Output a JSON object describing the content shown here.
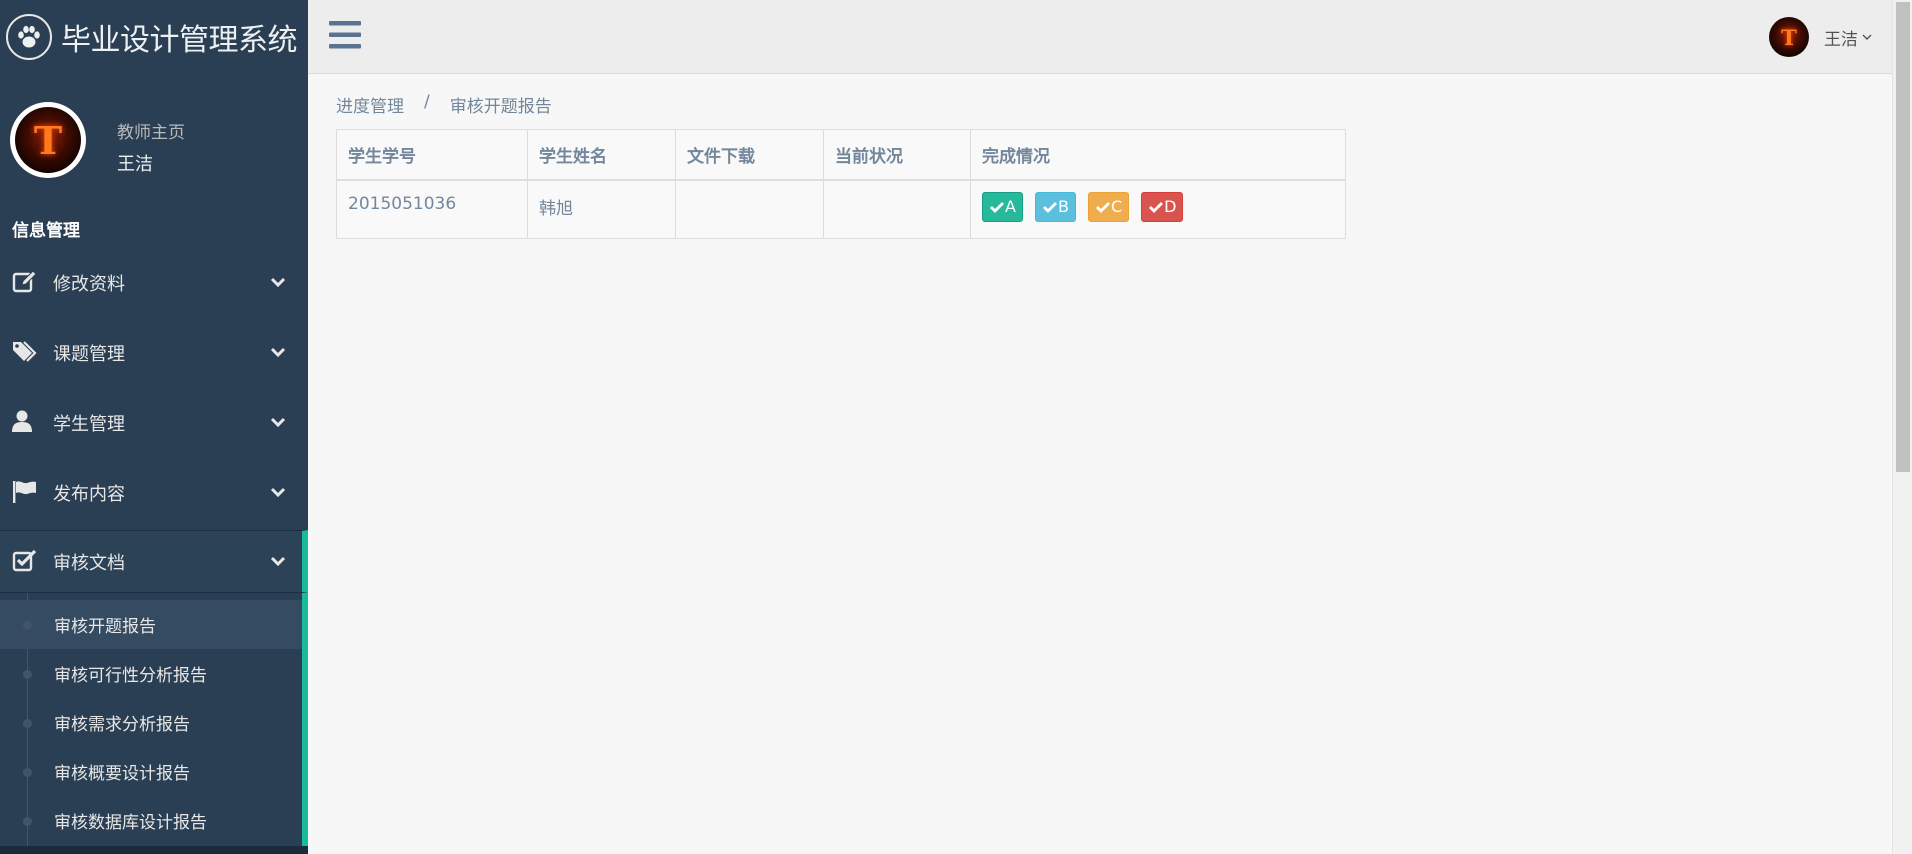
{
  "brand": {
    "title": "毕业设计管理系统",
    "icon": "paw-icon"
  },
  "profile": {
    "welcome": "教师主页",
    "name": "王洁",
    "avatar_letter": "T"
  },
  "sidebar": {
    "section_title": "信息管理",
    "menu": [
      {
        "label": "修改资料",
        "icon": "edit-icon"
      },
      {
        "label": "课题管理",
        "icon": "tags-icon"
      },
      {
        "label": "学生管理",
        "icon": "user-icon"
      },
      {
        "label": "发布内容",
        "icon": "flag-icon"
      },
      {
        "label": "审核文档",
        "icon": "check-square-icon"
      }
    ],
    "submenu": [
      "审核开题报告",
      "审核可行性分析报告",
      "审核需求分析报告",
      "审核概要设计报告",
      "审核数据库设计报告"
    ]
  },
  "topnav": {
    "user_name": "王洁",
    "avatar_letter": "T"
  },
  "breadcrumb": {
    "parent": "进度管理",
    "separator": "/",
    "current": "审核开题报告"
  },
  "table": {
    "headers": [
      "学生学号",
      "学生姓名",
      "文件下载",
      "当前状况",
      "完成情况"
    ],
    "rows": [
      {
        "student_id": "2015051036",
        "student_name": "韩旭",
        "download": "",
        "status": ""
      }
    ],
    "grade_buttons": [
      "A",
      "B",
      "C",
      "D"
    ]
  },
  "colors": {
    "sidebar_bg": "#2a3f54",
    "accent": "#1abb9c",
    "btn_a": "#26b99a",
    "btn_b": "#5bc0de",
    "btn_c": "#f0ad4e",
    "btn_d": "#d9534f"
  }
}
